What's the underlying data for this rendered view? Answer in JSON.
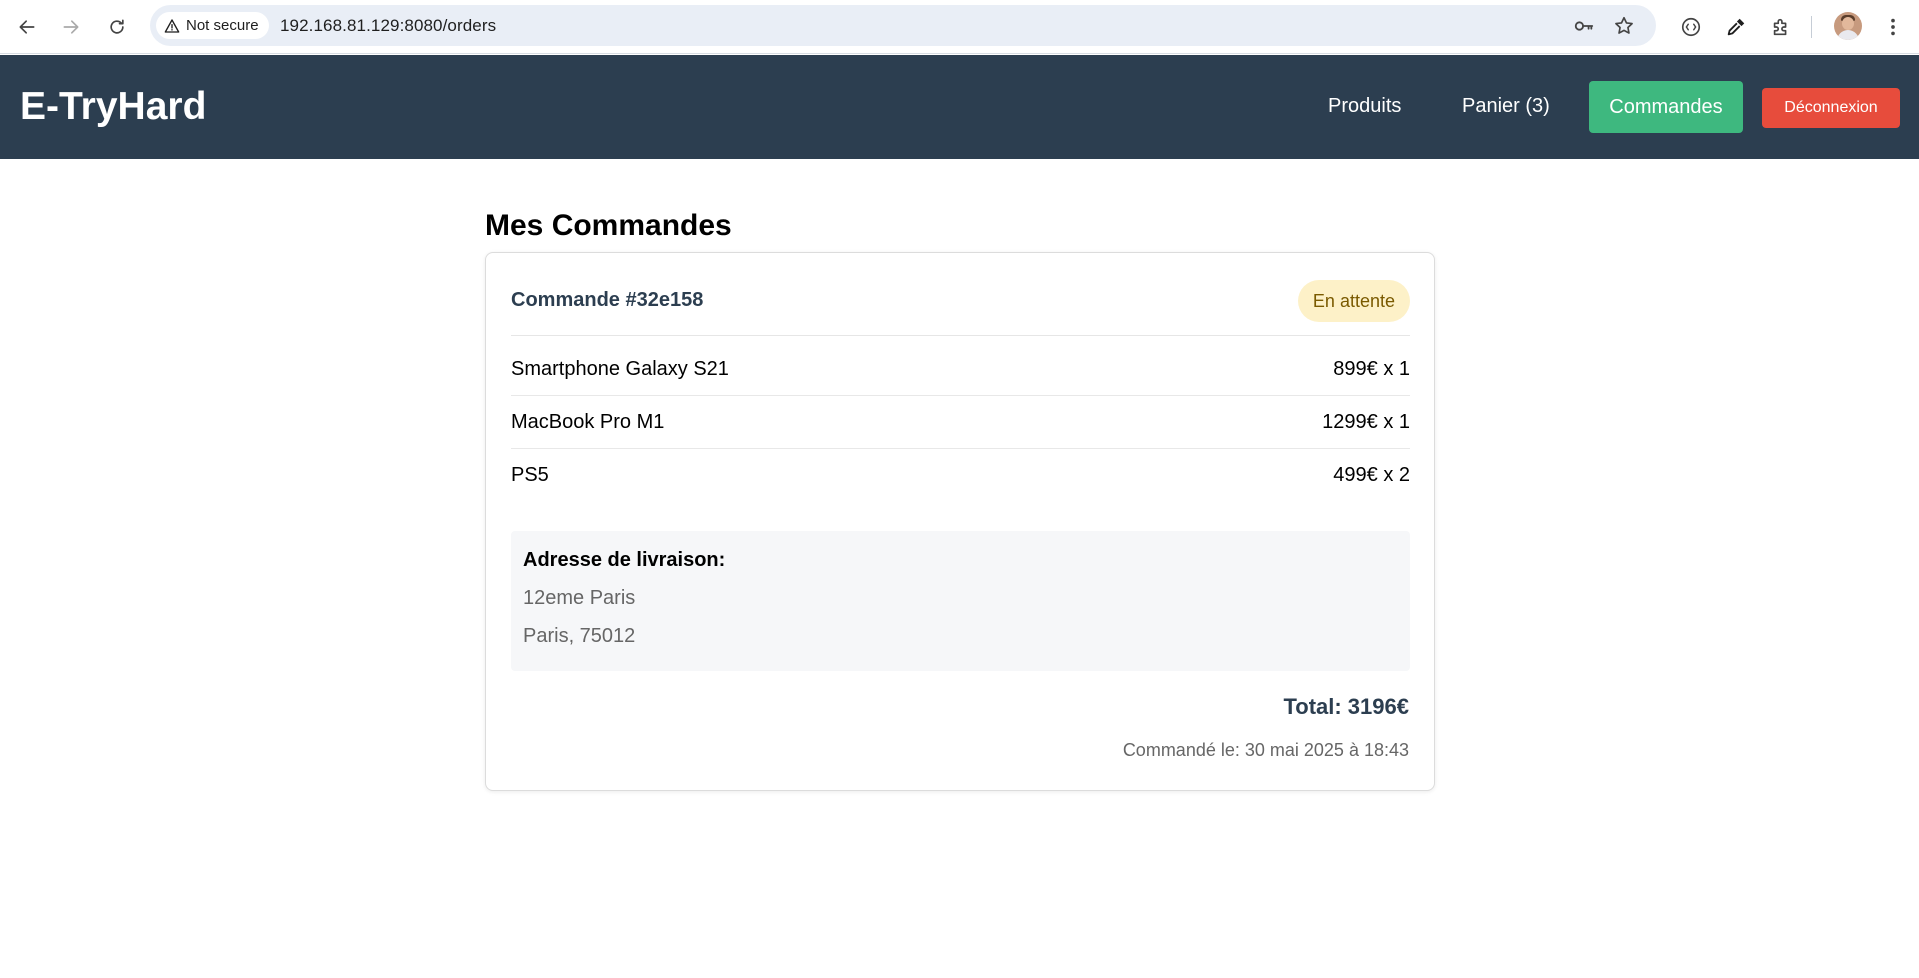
{
  "browser": {
    "security_label": "Not secure",
    "url": "192.168.81.129:8080/orders",
    "icons": [
      "back-icon",
      "forward-icon",
      "reload-icon",
      "warning-icon",
      "password-key-icon",
      "bookmark-star-icon",
      "media-router-icon",
      "eyedropper-icon",
      "extensions-icon",
      "profile-avatar",
      "menu-kebab-icon"
    ]
  },
  "header": {
    "brand": "E-TryHard",
    "nav": {
      "products": "Produits",
      "cart": "Panier (3)",
      "orders": "Commandes",
      "logout": "Déconnexion"
    },
    "colors": {
      "header_bg": "#2c3e50",
      "active_nav": "#3eb87f",
      "logout": "#e74c3c"
    }
  },
  "main": {
    "title": "Mes Commandes",
    "orders": [
      {
        "id_label": "Commande #32e158",
        "status": "En attente",
        "items": [
          {
            "name": "Smartphone Galaxy S21",
            "price_qty": "899€ x 1"
          },
          {
            "name": "MacBook Pro M1",
            "price_qty": "1299€ x 1"
          },
          {
            "name": "PS5",
            "price_qty": "499€ x 2"
          }
        ],
        "address": {
          "label": "Adresse de livraison:",
          "line1": "12eme Paris",
          "line2": "Paris, 75012"
        },
        "total": "Total: 3196€",
        "ordered_at": "Commandé le: 30 mai 2025 à 18:43"
      }
    ]
  }
}
